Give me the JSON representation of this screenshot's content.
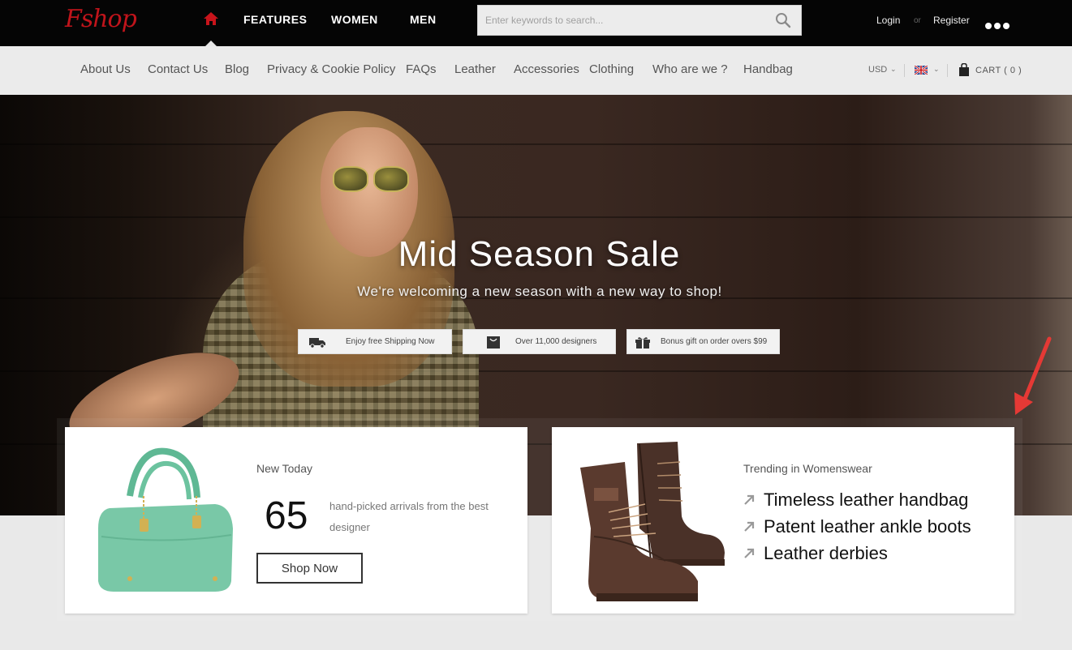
{
  "header": {
    "logo": "Fshop",
    "nav": [
      {
        "label": "FEATURES"
      },
      {
        "label": "WOMEN"
      },
      {
        "label": "MEN"
      }
    ],
    "search": {
      "placeholder": "Enter keywords to search..."
    },
    "login": "Login",
    "or": "or",
    "register": "Register"
  },
  "subnav": {
    "items": [
      {
        "label": "About Us"
      },
      {
        "label": "Contact Us"
      },
      {
        "label": "Blog"
      },
      {
        "label": "Privacy & Cookie Policy"
      },
      {
        "label": "FAQs"
      },
      {
        "label": "Leather"
      },
      {
        "label": "Accessories"
      },
      {
        "label": "Clothing"
      },
      {
        "label": "Who are we ?"
      },
      {
        "label": "Handbag"
      }
    ],
    "currency": "USD",
    "cart": "CART ( 0 )"
  },
  "hero": {
    "title": "Mid Season Sale",
    "subtitle": "We're welcoming a new season with a new way to shop!",
    "badges": [
      {
        "label": "Enjoy  free Shipping Now",
        "icon": "truck-icon"
      },
      {
        "label": "Over 11,000 designers",
        "icon": "bag-icon"
      },
      {
        "label": "Bonus gift on order overs $99",
        "icon": "gift-icon"
      }
    ]
  },
  "promo": {
    "new_today": {
      "heading": "New Today",
      "count": "65",
      "description": "hand-picked arrivals from the best designer",
      "button": "Shop Now"
    },
    "trending": {
      "heading": "Trending in Womenswear",
      "items": [
        {
          "label": "Timeless leather handbag"
        },
        {
          "label": "Patent leather ankle boots"
        },
        {
          "label": "Leather derbies"
        }
      ]
    }
  },
  "colors": {
    "brand": "#c0141b",
    "topbar": "#050505",
    "subbar": "#ebebeb",
    "annotation_arrow": "#e53935"
  }
}
